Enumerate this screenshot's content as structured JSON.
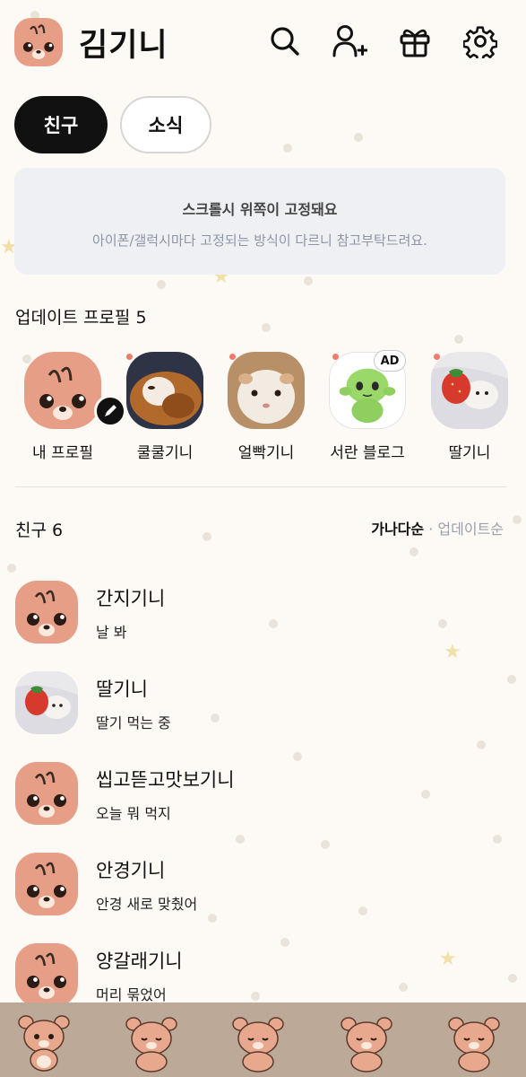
{
  "header": {
    "title": "김기니",
    "icons": [
      "search-icon",
      "add-friend-icon",
      "gift-icon",
      "settings-icon"
    ]
  },
  "tabs": [
    {
      "label": "친구",
      "active": true
    },
    {
      "label": "소식",
      "active": false
    }
  ],
  "notice": {
    "title": "스크롤시 위쪽이 고정돼요",
    "subtitle": "아이폰/갤럭시마다 고정되는 방식이 다르니 참고부탁드려요."
  },
  "updated_profiles": {
    "title": "업데이트 프로필 5",
    "items": [
      {
        "name": "내 프로필",
        "image": "bear-avatar",
        "edit": true
      },
      {
        "name": "쿨쿨기니",
        "image": "guinea-pig-sleeping",
        "new": true
      },
      {
        "name": "얼빡기니",
        "image": "guinea-pig-closeup",
        "new": true
      },
      {
        "name": "서란 블로그",
        "image": "green-alien-plush",
        "new": true,
        "badge": "AD"
      },
      {
        "name": "딸기니",
        "image": "strawberry-hat-hamster",
        "new": true
      }
    ]
  },
  "friends": {
    "title": "친구 6",
    "sort_selected": "가나다순",
    "sort_separator": "·",
    "sort_other": "업데이트순",
    "items": [
      {
        "name": "간지기니",
        "status": "날 봐",
        "image": "bear-avatar"
      },
      {
        "name": "딸기니",
        "status": "딸기 먹는 중",
        "image": "strawberry-hat-hamster"
      },
      {
        "name": "씹고뜯고맛보기니",
        "status": "오늘 뭐 먹지",
        "image": "bear-avatar"
      },
      {
        "name": "안경기니",
        "status": "안경 새로 맞췄어",
        "image": "bear-avatar"
      },
      {
        "name": "양갈래기니",
        "status": "머리 묶었어",
        "image": "bear-avatar"
      }
    ]
  },
  "bottom_tabs": [
    "bear-waving-icon",
    "bear-sleeping-icon",
    "bear-sleeping-icon",
    "bear-sleeping-icon",
    "bear-sleeping-icon"
  ],
  "colors": {
    "background": "#fdfaf5",
    "avatar_skin": "#e79e86",
    "active_tab": "#111111",
    "notice_bg": "#eff0f4",
    "tabbar": "#bda998",
    "new_dot": "#f07a6e"
  }
}
